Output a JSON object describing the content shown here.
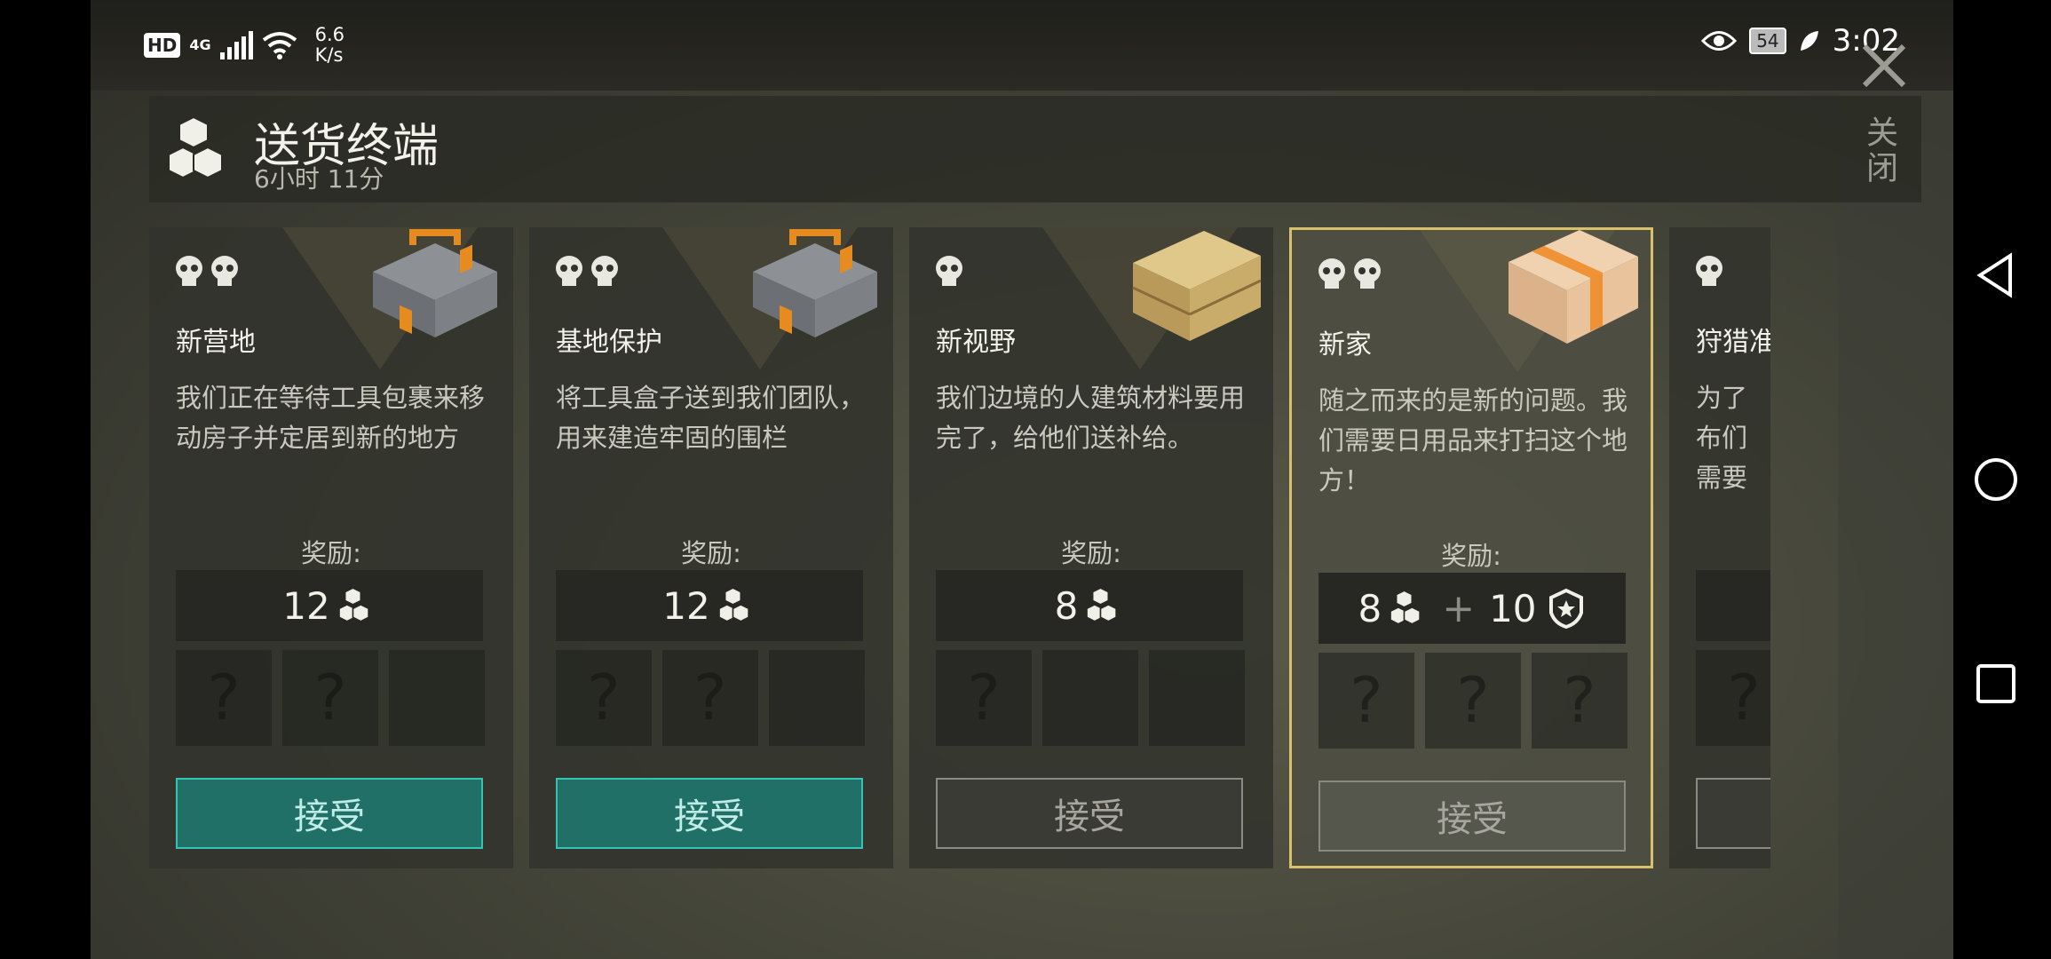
{
  "status": {
    "hd": "HD",
    "network": "4G",
    "speed_value": "6.6",
    "speed_unit": "K/s",
    "battery": "54",
    "time": "3:02"
  },
  "header": {
    "title": "送货终端",
    "timer": "6小时 11分",
    "close_label": "关闭"
  },
  "cards": [
    {
      "name": "新营地",
      "skulls": 2,
      "item": "toolbox",
      "desc": "我们正在等待工具包裹来移动房子并定居到新的地方",
      "reward_label": "奖励:",
      "reward_amount": "12",
      "reward_extra": null,
      "slots": [
        "?",
        "?",
        ""
      ],
      "button": "接受",
      "button_state": "active"
    },
    {
      "name": "基地保护",
      "skulls": 2,
      "item": "toolbox",
      "desc": "将工具盒子送到我们团队，用来建造牢固的围栏",
      "reward_label": "奖励:",
      "reward_amount": "12",
      "reward_extra": null,
      "slots": [
        "?",
        "?",
        ""
      ],
      "button": "接受",
      "button_state": "active"
    },
    {
      "name": "新视野",
      "skulls": 1,
      "item": "wooden-crate",
      "desc": "我们边境的人建筑材料要用完了，给他们送补给。",
      "reward_label": "奖励:",
      "reward_amount": "8",
      "reward_extra": null,
      "slots": [
        "?",
        "",
        ""
      ],
      "button": "接受",
      "button_state": "inactive"
    },
    {
      "name": "新家",
      "skulls": 2,
      "item": "cardboard-box",
      "desc": "随之而来的是新的问题。我们需要日用品来打扫这个地方！",
      "reward_label": "奖励:",
      "reward_amount": "8",
      "reward_extra": "10",
      "slots": [
        "?",
        "?",
        "?"
      ],
      "button": "接受",
      "button_state": "inactive",
      "selected": true
    },
    {
      "name": "狩猎准",
      "skulls": 1,
      "item": "none",
      "desc": "为了布们需要",
      "reward_label": "",
      "reward_amount": "",
      "reward_extra": null,
      "slots": [
        "?",
        "",
        ""
      ],
      "button": "",
      "button_state": "inactive"
    }
  ],
  "icons": {
    "cube": "cube-stack-icon",
    "skull": "skull-icon",
    "badge": "shield-star-icon",
    "close": "close-icon",
    "back": "nav-back-icon",
    "home": "nav-home-icon",
    "recent": "nav-recent-icon"
  },
  "colors": {
    "accept_active": "#217068",
    "selected_border": "#d9c06a"
  }
}
